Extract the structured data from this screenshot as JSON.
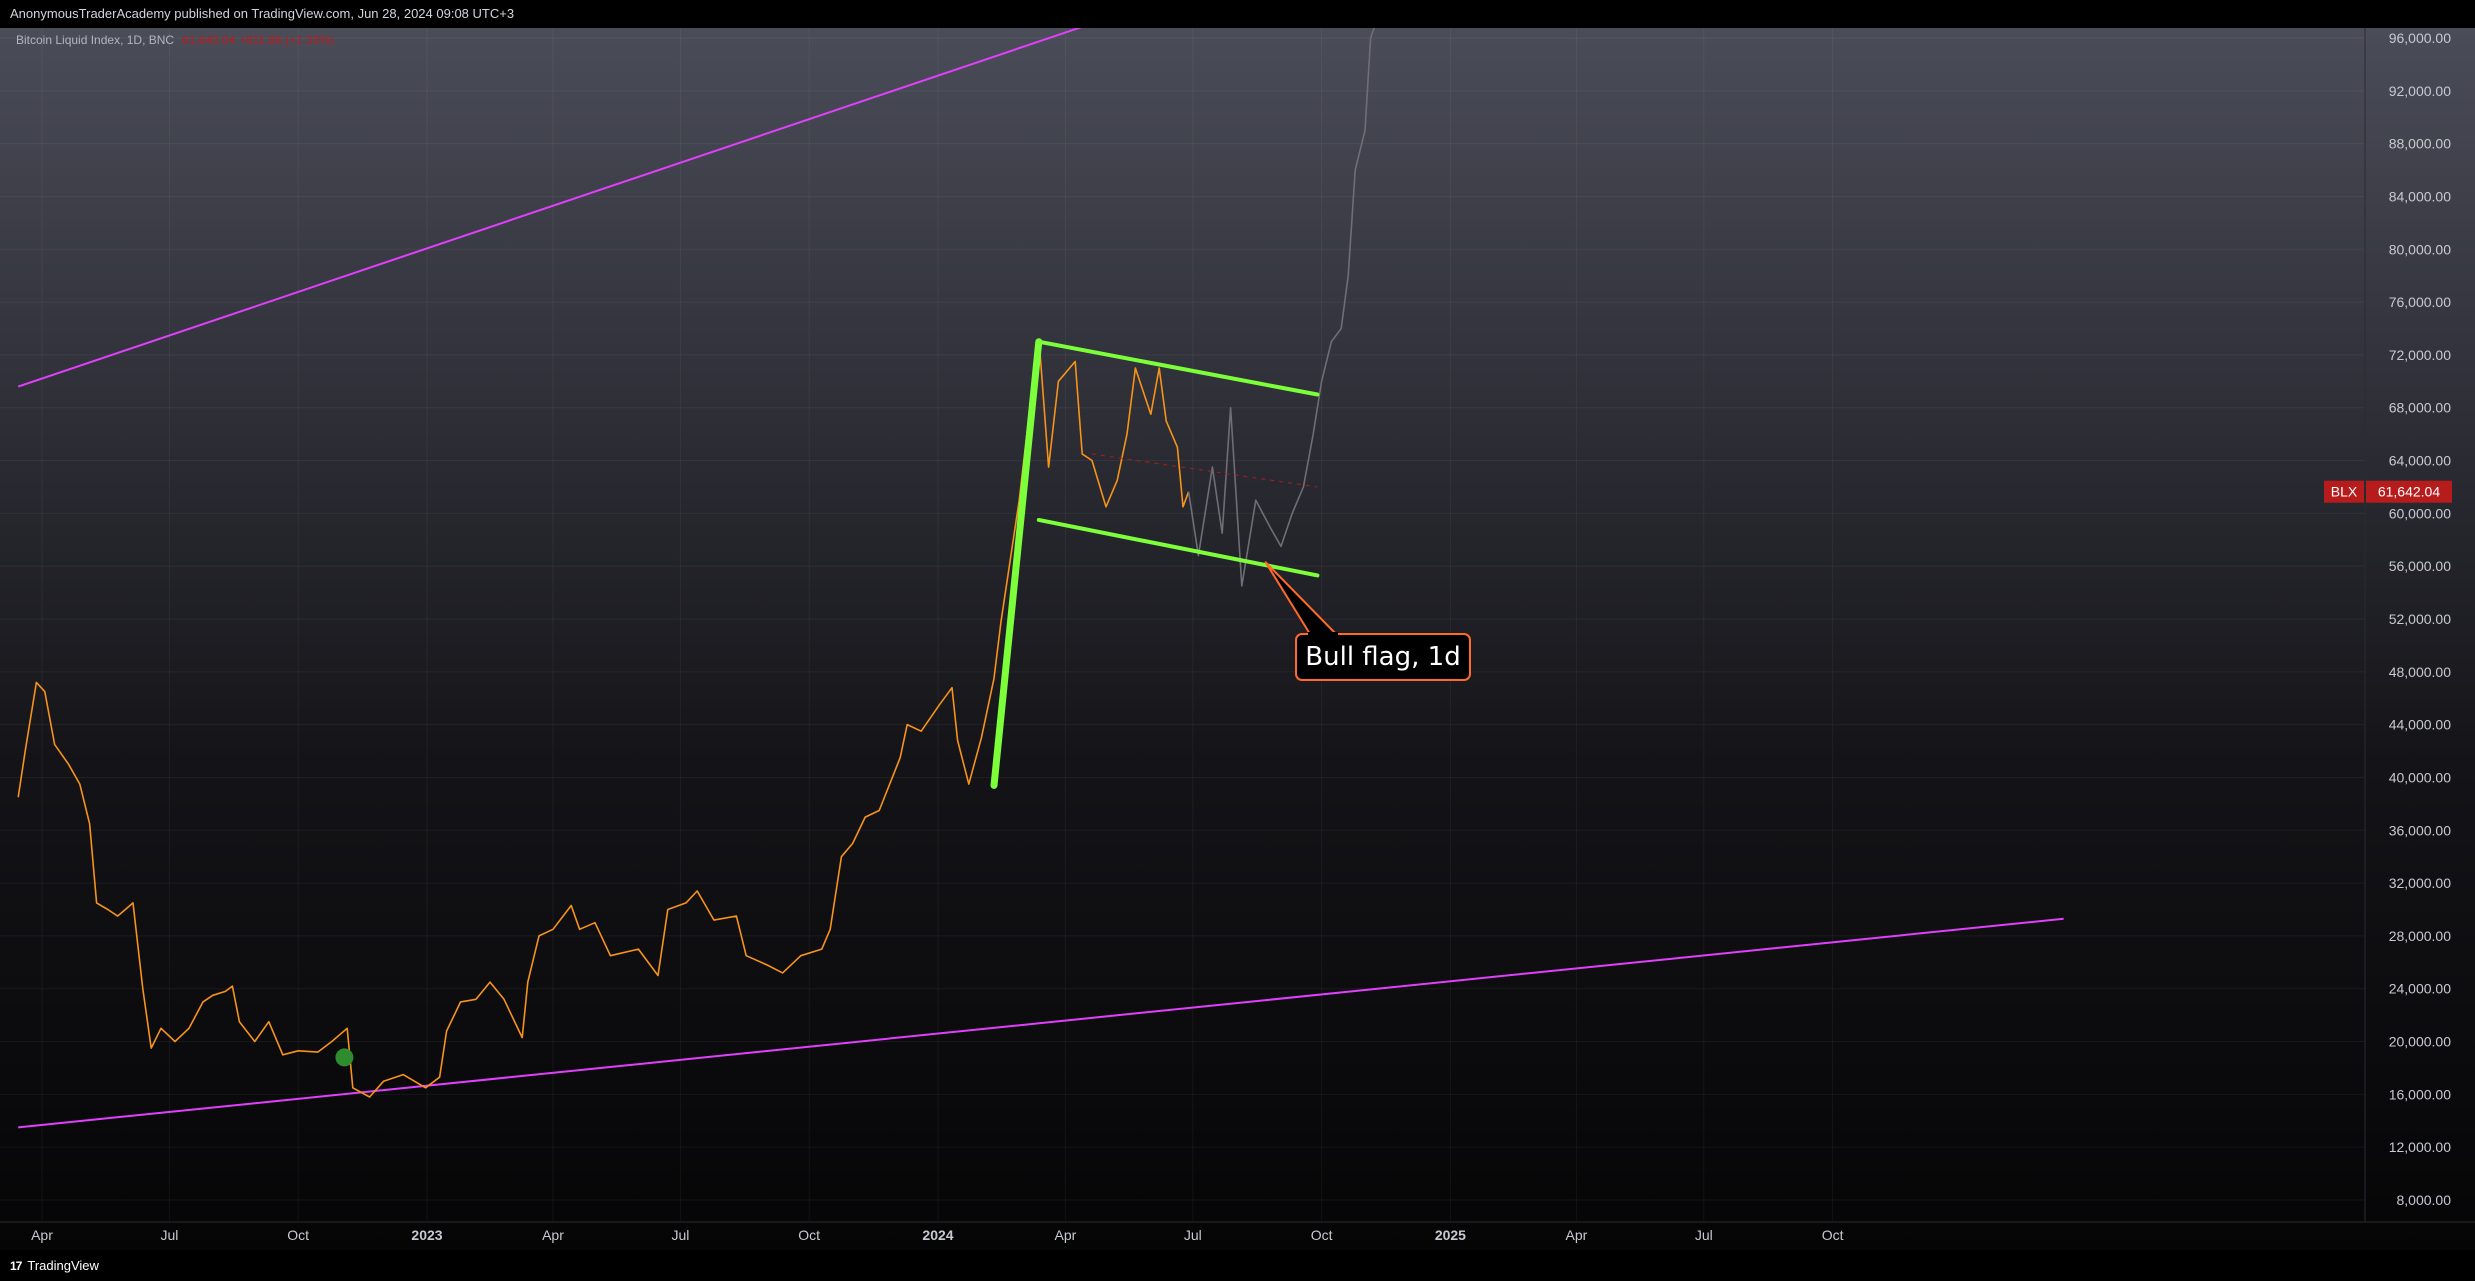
{
  "header": {
    "publish_info": "AnonymousTraderAcademy published on TradingView.com, Jun 28, 2024 09:08 UTC+3"
  },
  "footer": {
    "brand": "TradingView",
    "logo_glyph": "17"
  },
  "colors": {
    "price": "#f7931a",
    "projection": "#6e6e76",
    "flag_lines": "#7cff3a",
    "channel": "#e040fb",
    "annotation_border": "#ff6a2a",
    "badge": "#b71c1c"
  },
  "chart_data": {
    "type": "line",
    "symbol": "Bitcoin Liquid Index, 1D, BNC",
    "legend_values": "61,642.04  +811.86 (+1.33%)",
    "ylim": [
      7000,
      97000
    ],
    "y_ticks": [
      "96,000.00",
      "92,000.00",
      "88,000.00",
      "84,000.00",
      "80,000.00",
      "76,000.00",
      "72,000.00",
      "68,000.00",
      "64,000.00",
      "60,000.00",
      "56,000.00",
      "52,000.00",
      "48,000.00",
      "44,000.00",
      "40,000.00",
      "36,000.00",
      "32,000.00",
      "28,000.00",
      "24,000.00",
      "20,000.00",
      "16,000.00",
      "12,000.00",
      "8,000.00"
    ],
    "x_ticks": [
      {
        "label": "Apr",
        "date": "2022-04-01",
        "bold": false
      },
      {
        "label": "Jul",
        "date": "2022-07-01",
        "bold": false
      },
      {
        "label": "Oct",
        "date": "2022-10-01",
        "bold": false
      },
      {
        "label": "2023",
        "date": "2023-01-01",
        "bold": true
      },
      {
        "label": "Apr",
        "date": "2023-04-01",
        "bold": false
      },
      {
        "label": "Jul",
        "date": "2023-07-01",
        "bold": false
      },
      {
        "label": "Oct",
        "date": "2023-10-01",
        "bold": false
      },
      {
        "label": "2024",
        "date": "2024-01-01",
        "bold": true
      },
      {
        "label": "Apr",
        "date": "2024-04-01",
        "bold": false
      },
      {
        "label": "Jul",
        "date": "2024-07-01",
        "bold": false
      },
      {
        "label": "Oct",
        "date": "2024-10-01",
        "bold": false
      },
      {
        "label": "2025",
        "date": "2025-01-01",
        "bold": true
      },
      {
        "label": "Apr",
        "date": "2025-04-01",
        "bold": false
      },
      {
        "label": "Jul",
        "date": "2025-07-01",
        "bold": false
      },
      {
        "label": "Oct",
        "date": "2025-10-01",
        "bold": false
      }
    ],
    "price_badge": {
      "label": "BLX",
      "value": "61,642.04",
      "price": 61642.04
    },
    "series": [
      {
        "role": "price",
        "points": [
          [
            "2022-03-15",
            38500
          ],
          [
            "2022-03-20",
            42000
          ],
          [
            "2022-03-28",
            47200
          ],
          [
            "2022-04-03",
            46500
          ],
          [
            "2022-04-10",
            42500
          ],
          [
            "2022-04-20",
            41000
          ],
          [
            "2022-04-28",
            39500
          ],
          [
            "2022-05-05",
            36500
          ],
          [
            "2022-05-10",
            30500
          ],
          [
            "2022-05-18",
            30000
          ],
          [
            "2022-05-25",
            29500
          ],
          [
            "2022-06-05",
            30500
          ],
          [
            "2022-06-12",
            24000
          ],
          [
            "2022-06-18",
            19500
          ],
          [
            "2022-06-25",
            21000
          ],
          [
            "2022-07-05",
            20000
          ],
          [
            "2022-07-15",
            21000
          ],
          [
            "2022-07-25",
            23000
          ],
          [
            "2022-08-01",
            23500
          ],
          [
            "2022-08-10",
            23800
          ],
          [
            "2022-08-15",
            24200
          ],
          [
            "2022-08-20",
            21500
          ],
          [
            "2022-08-31",
            20000
          ],
          [
            "2022-09-10",
            21500
          ],
          [
            "2022-09-20",
            19000
          ],
          [
            "2022-10-01",
            19300
          ],
          [
            "2022-10-15",
            19200
          ],
          [
            "2022-10-25",
            20000
          ],
          [
            "2022-11-05",
            21000
          ],
          [
            "2022-11-09",
            16500
          ],
          [
            "2022-11-21",
            15800
          ],
          [
            "2022-12-01",
            17000
          ],
          [
            "2022-12-15",
            17500
          ],
          [
            "2022-12-31",
            16500
          ],
          [
            "2023-01-10",
            17300
          ],
          [
            "2023-01-15",
            20800
          ],
          [
            "2023-01-25",
            23000
          ],
          [
            "2023-02-05",
            23200
          ],
          [
            "2023-02-15",
            24500
          ],
          [
            "2023-02-25",
            23200
          ],
          [
            "2023-03-10",
            20300
          ],
          [
            "2023-03-14",
            24500
          ],
          [
            "2023-03-22",
            28000
          ],
          [
            "2023-04-01",
            28500
          ],
          [
            "2023-04-14",
            30300
          ],
          [
            "2023-04-20",
            28500
          ],
          [
            "2023-05-01",
            29000
          ],
          [
            "2023-05-12",
            26500
          ],
          [
            "2023-06-01",
            27000
          ],
          [
            "2023-06-15",
            25000
          ],
          [
            "2023-06-22",
            30000
          ],
          [
            "2023-07-05",
            30500
          ],
          [
            "2023-07-13",
            31400
          ],
          [
            "2023-07-25",
            29200
          ],
          [
            "2023-08-10",
            29500
          ],
          [
            "2023-08-17",
            26500
          ],
          [
            "2023-09-01",
            25800
          ],
          [
            "2023-09-12",
            25200
          ],
          [
            "2023-09-25",
            26500
          ],
          [
            "2023-10-10",
            27000
          ],
          [
            "2023-10-16",
            28500
          ],
          [
            "2023-10-24",
            34000
          ],
          [
            "2023-11-01",
            35000
          ],
          [
            "2023-11-10",
            37000
          ],
          [
            "2023-11-20",
            37500
          ],
          [
            "2023-12-05",
            41500
          ],
          [
            "2023-12-10",
            44000
          ],
          [
            "2023-12-20",
            43500
          ],
          [
            "2024-01-02",
            45500
          ],
          [
            "2024-01-11",
            46800
          ],
          [
            "2024-01-15",
            42800
          ],
          [
            "2024-01-23",
            39500
          ],
          [
            "2024-02-01",
            43000
          ],
          [
            "2024-02-10",
            47500
          ],
          [
            "2024-02-15",
            51800
          ],
          [
            "2024-02-28",
            61000
          ],
          [
            "2024-03-05",
            66500
          ],
          [
            "2024-03-14",
            72000
          ],
          [
            "2024-03-20",
            63500
          ],
          [
            "2024-03-27",
            70000
          ],
          [
            "2024-04-08",
            71500
          ],
          [
            "2024-04-13",
            64500
          ],
          [
            "2024-04-20",
            64000
          ],
          [
            "2024-04-30",
            60500
          ],
          [
            "2024-05-08",
            62500
          ],
          [
            "2024-05-15",
            66000
          ],
          [
            "2024-05-21",
            71000
          ],
          [
            "2024-06-01",
            67500
          ],
          [
            "2024-06-07",
            71000
          ],
          [
            "2024-06-12",
            67000
          ],
          [
            "2024-06-20",
            65000
          ],
          [
            "2024-06-24",
            60500
          ],
          [
            "2024-06-28",
            61642
          ]
        ]
      },
      {
        "role": "projection",
        "points": [
          [
            "2024-06-28",
            61642
          ],
          [
            "2024-07-05",
            56800
          ],
          [
            "2024-07-15",
            63500
          ],
          [
            "2024-07-22",
            58500
          ],
          [
            "2024-07-28",
            68000
          ],
          [
            "2024-08-05",
            54500
          ],
          [
            "2024-08-15",
            61000
          ],
          [
            "2024-08-25",
            59000
          ],
          [
            "2024-09-02",
            57500
          ],
          [
            "2024-09-10",
            60000
          ],
          [
            "2024-09-18",
            62000
          ],
          [
            "2024-09-25",
            66000
          ],
          [
            "2024-10-01",
            70000
          ],
          [
            "2024-10-08",
            73000
          ],
          [
            "2024-10-15",
            74000
          ],
          [
            "2024-10-20",
            78000
          ],
          [
            "2024-10-25",
            86000
          ],
          [
            "2024-11-01",
            89000
          ],
          [
            "2024-11-05",
            96000
          ],
          [
            "2024-11-10",
            97500
          ]
        ]
      }
    ],
    "drawings": {
      "pole": [
        [
          "2024-02-10",
          39400
        ],
        [
          "2024-03-13",
          73000
        ]
      ],
      "flag_top": [
        [
          "2024-03-13",
          73000
        ],
        [
          "2024-09-28",
          69000
        ]
      ],
      "flag_bottom": [
        [
          "2024-03-13",
          59500
        ],
        [
          "2024-09-28",
          55300
        ]
      ],
      "flag_mid": [
        [
          "2024-04-20",
          64500
        ],
        [
          "2024-09-28",
          62000
        ]
      ],
      "channel_upper": [
        [
          "2022-03-15",
          69600
        ],
        [
          "2024-07-10",
          100000
        ]
      ],
      "channel_lower": [
        [
          "2022-03-15",
          13500
        ],
        [
          "2026-03-15",
          29300
        ]
      ],
      "marker": {
        "date": "2022-11-03",
        "value": 18800
      }
    },
    "annotation": {
      "text": "Bull flag, 1d",
      "pointer_date": "2024-08-22",
      "pointer_value": 56300
    }
  }
}
